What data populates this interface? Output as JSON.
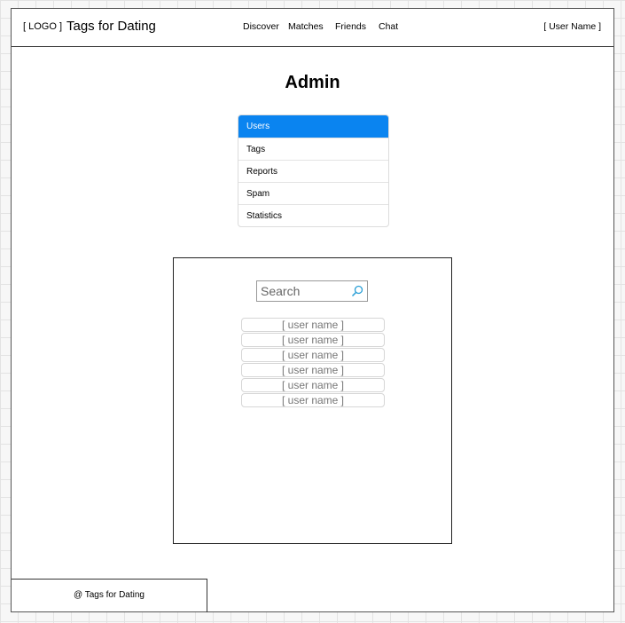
{
  "header": {
    "logo": "[ LOGO ]",
    "site_title": "Tags for Dating",
    "nav": [
      "Discover",
      "Matches",
      "Friends",
      "Chat"
    ],
    "user_name": "[ User Name ]"
  },
  "main": {
    "title": "Admin",
    "menu": [
      {
        "label": "Users",
        "active": true
      },
      {
        "label": "Tags"
      },
      {
        "label": "Reports"
      },
      {
        "label": "Spam"
      },
      {
        "label": "Statistics"
      }
    ],
    "search": {
      "placeholder": "Search",
      "icon": "search-icon"
    },
    "users": [
      "[ user name ]",
      "[ user name ]",
      "[ user name ]",
      "[ user name ]",
      "[ user name ]",
      "[ user name ]"
    ]
  },
  "footer": {
    "text": "@ Tags for Dating"
  },
  "colors": {
    "accent": "#0a84f0"
  }
}
